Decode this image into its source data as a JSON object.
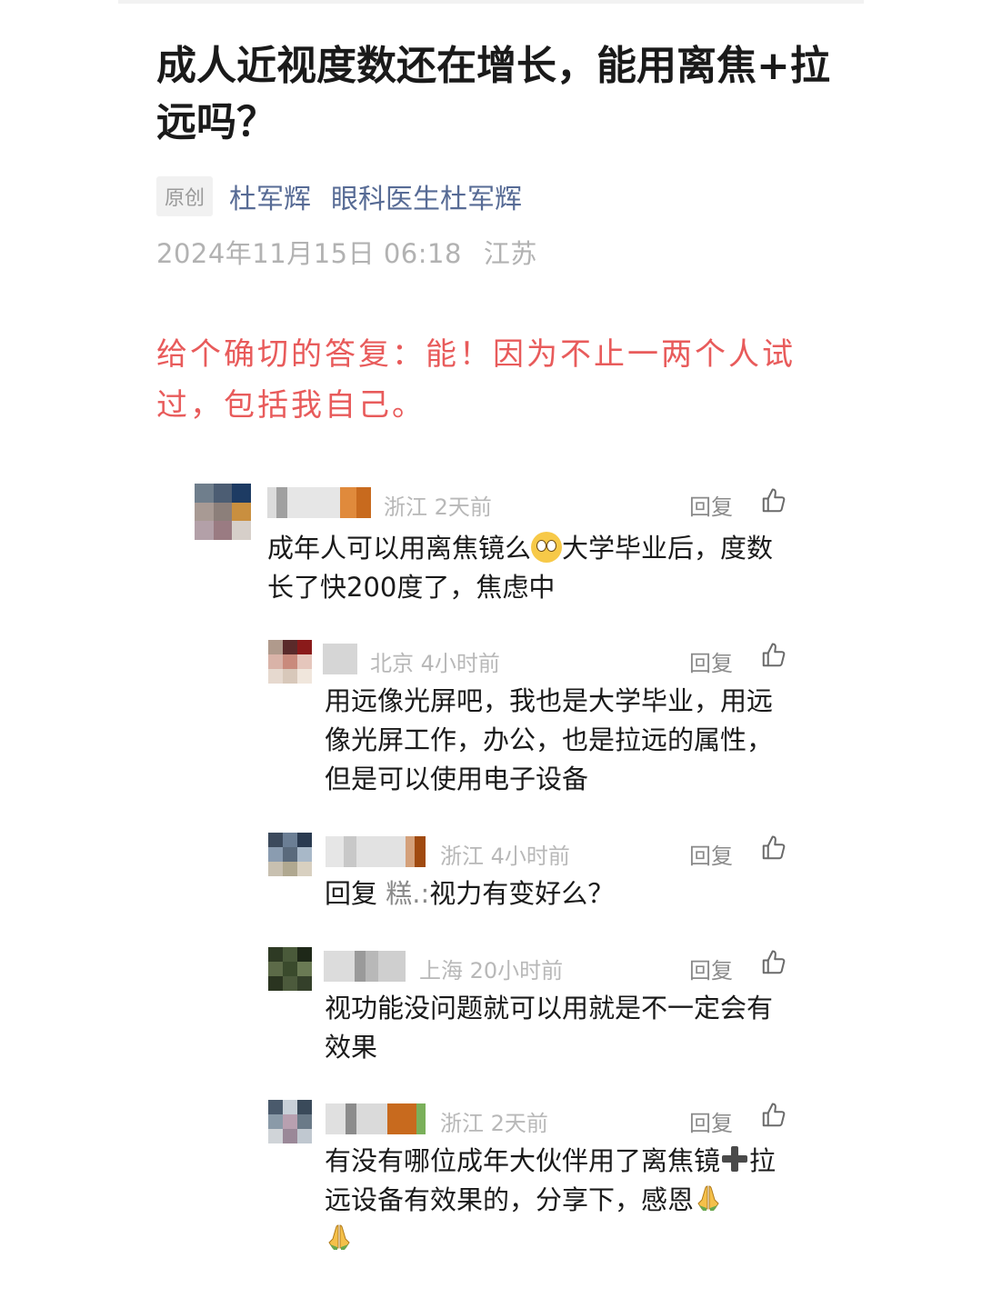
{
  "article": {
    "title": "成人近视度数还在增长，能用离焦+拉远吗？",
    "tag": "原创",
    "author": "杜军辉",
    "account": "眼科医生杜军辉",
    "date": "2024年11月15日 06:18",
    "location": "江苏",
    "answer": "给个确切的答复：能！因为不止一两个人试过，包括我自己。"
  },
  "reply_label": "回复",
  "icons": {
    "like": "thumbs-up-icon",
    "emoji": "grimace-face-icon",
    "plus": "heavy-plus-icon",
    "pray": "folded-hands-icon"
  },
  "comments": [
    {
      "region": "浙江 2天前",
      "text_a": "成年人可以用离焦镜么",
      "text_b": "大学毕业后，度数长了快200度了，焦虑中"
    },
    {
      "region": "北京 4小时前",
      "text": "用远像光屏吧，我也是大学毕业，用远像光屏工作，办公，也是拉远的属性，但是可以使用电子设备"
    },
    {
      "region": "浙江 4小时前",
      "reply_prefix": "回复",
      "reply_to": "糕.:",
      "text": "视力有变好么？"
    },
    {
      "region": "上海 20小时前",
      "text": "视功能没问题就可以用就是不一定会有效果"
    },
    {
      "region": "浙江 2天前",
      "text_a": "有没有哪位成年大伙伴用了离焦镜",
      "text_b": "拉远设备有效果的，分享下，感恩"
    }
  ]
}
